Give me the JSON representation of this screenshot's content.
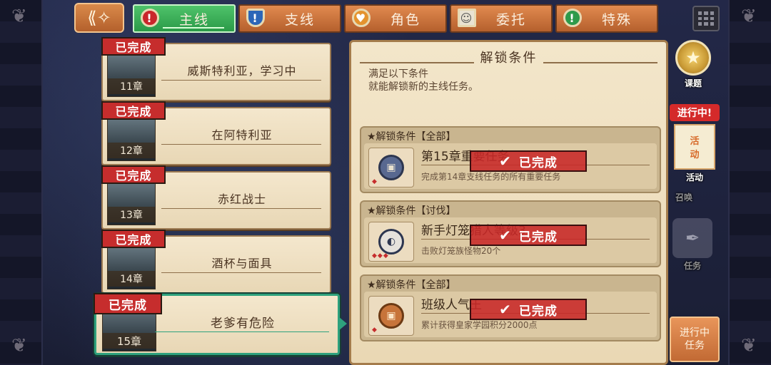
{
  "tabs": [
    {
      "label": "主线",
      "icon": "red-exclamation-icon",
      "active": true
    },
    {
      "label": "支线",
      "icon": "blue-shield-icon",
      "active": false
    },
    {
      "label": "角色",
      "icon": "orange-heart-icon",
      "active": false
    },
    {
      "label": "委托",
      "icon": "portrait-document-icon",
      "active": false
    },
    {
      "label": "特殊",
      "icon": "green-key-icon",
      "active": false
    }
  ],
  "chapters": [
    {
      "title": "威斯特利亚，学习中",
      "num": "11章",
      "status": "已完成"
    },
    {
      "title": "在阿特利亚",
      "num": "12章",
      "status": "已完成"
    },
    {
      "title": "赤红战士",
      "num": "13章",
      "status": "已完成"
    },
    {
      "title": "酒杯与面具",
      "num": "14章",
      "status": "已完成"
    },
    {
      "title": "老爹有危险",
      "num": "15章",
      "status": "已完成",
      "selected": true
    }
  ],
  "panel": {
    "title": "解锁条件",
    "desc_line1": "满足以下条件",
    "desc_line2": "就能解锁新的主线任务。",
    "conditions": [
      {
        "head": "★解锁条件【全部】",
        "name": "第15章重要任务",
        "detail": "完成第14章支线任务的所有重要任务",
        "status": "已完成",
        "difficulty": 1
      },
      {
        "head": "★解锁条件【讨伐】",
        "name": "新手灯笼猎人等级3",
        "detail": "击败灯笼族怪物20个",
        "status": "已完成",
        "difficulty": 3
      },
      {
        "head": "★解锁条件【全部】",
        "name": "班级人气王",
        "detail": "累计获得皇家学园积分2000点",
        "status": "已完成",
        "difficulty": 1
      }
    ]
  },
  "sidebar": {
    "topic_label": "课题",
    "in_progress_label": "进行中!",
    "activity_label": "活动",
    "activity_card_line1": "活",
    "activity_card_line2": "动",
    "summon_label": "召唤",
    "task_label": "任务",
    "ongoing_task_line1": "进行中",
    "ongoing_task_line2": "任务"
  },
  "colors": {
    "active_tab": "#2b9a48",
    "tab": "#b5602d",
    "done_badge": "#c62d2d",
    "panel": "#f3e6ca"
  }
}
